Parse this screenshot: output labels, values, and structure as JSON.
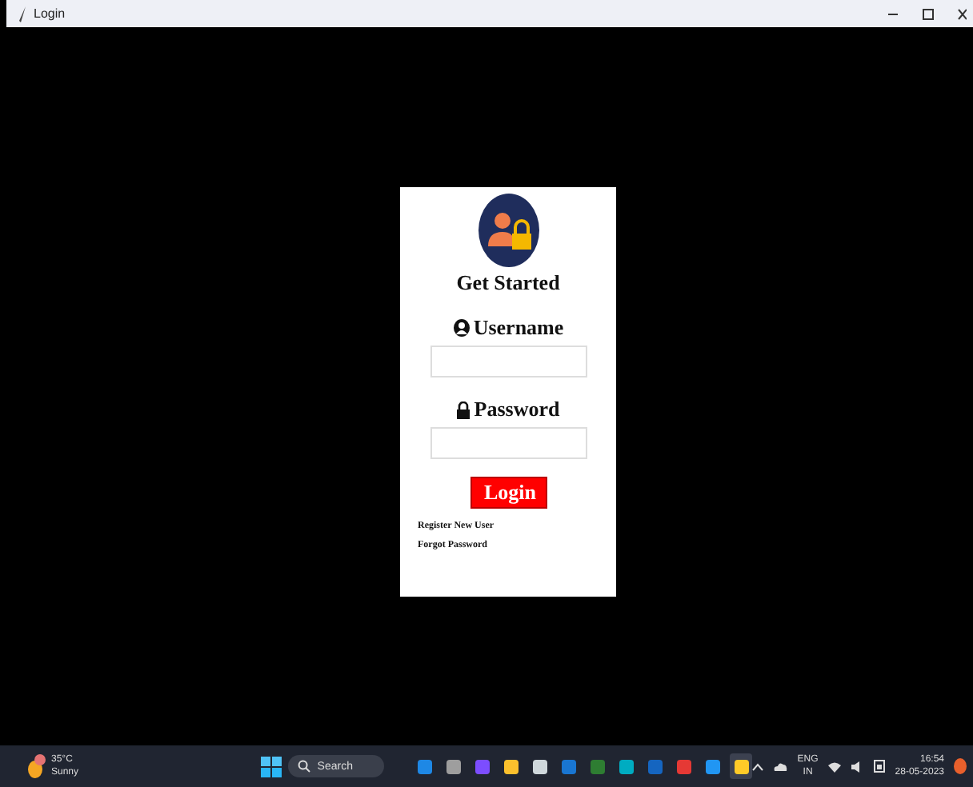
{
  "window": {
    "title": "Login"
  },
  "form": {
    "heading": "Get Started",
    "username_label": "Username",
    "password_label": "Password",
    "login_button": "Login",
    "links": [
      "Register New User",
      "Forgot Password"
    ]
  },
  "taskbar": {
    "weather": {
      "temperature": "35°C",
      "condition": "Sunny"
    },
    "search": {
      "placeholder": "Search"
    },
    "apps": [
      {
        "color": "#1e88e5",
        "selected": false
      },
      {
        "color": "#9e9e9e",
        "selected": false
      },
      {
        "color": "#7c4dff",
        "selected": false
      },
      {
        "color": "#fbc02d",
        "selected": false
      },
      {
        "color": "#cfd8dc",
        "selected": false
      },
      {
        "color": "#1976d2",
        "selected": false
      },
      {
        "color": "#2e7d32",
        "selected": false
      },
      {
        "color": "#00acc1",
        "selected": false
      },
      {
        "color": "#1565c0",
        "selected": false
      },
      {
        "color": "#e53935",
        "selected": false
      },
      {
        "color": "#2196f3",
        "selected": false
      },
      {
        "color": "#ffca28",
        "selected": true
      }
    ],
    "language": "ENG",
    "region": "IN",
    "time": "16:54",
    "date": "28-05-2023"
  }
}
